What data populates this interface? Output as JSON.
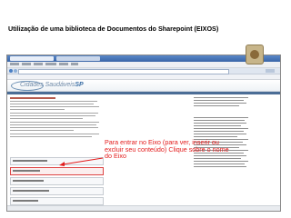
{
  "slide": {
    "title": "Utilização de uma biblioteca de Documentos do Sharepoint (EIXOS)"
  },
  "browser": {
    "logo": {
      "prefix": "Cidades Saudáveis",
      "suffix": "SP"
    }
  },
  "side_list": {
    "items": [
      {
        "label": ""
      },
      {
        "label": ""
      },
      {
        "label": ""
      },
      {
        "label": ""
      },
      {
        "label": ""
      },
      {
        "label": ""
      },
      {
        "label": ""
      },
      {
        "label": ""
      }
    ]
  },
  "callout": {
    "text": "Para entrar no Eixo (para ver, inserir ou excluir seu conteúdo) Clique sobre o nome do Eixo"
  },
  "colors": {
    "callout": "#e31b1b",
    "banner_logo": "#3b6ea5",
    "nav_strip": "#4b6d96"
  }
}
